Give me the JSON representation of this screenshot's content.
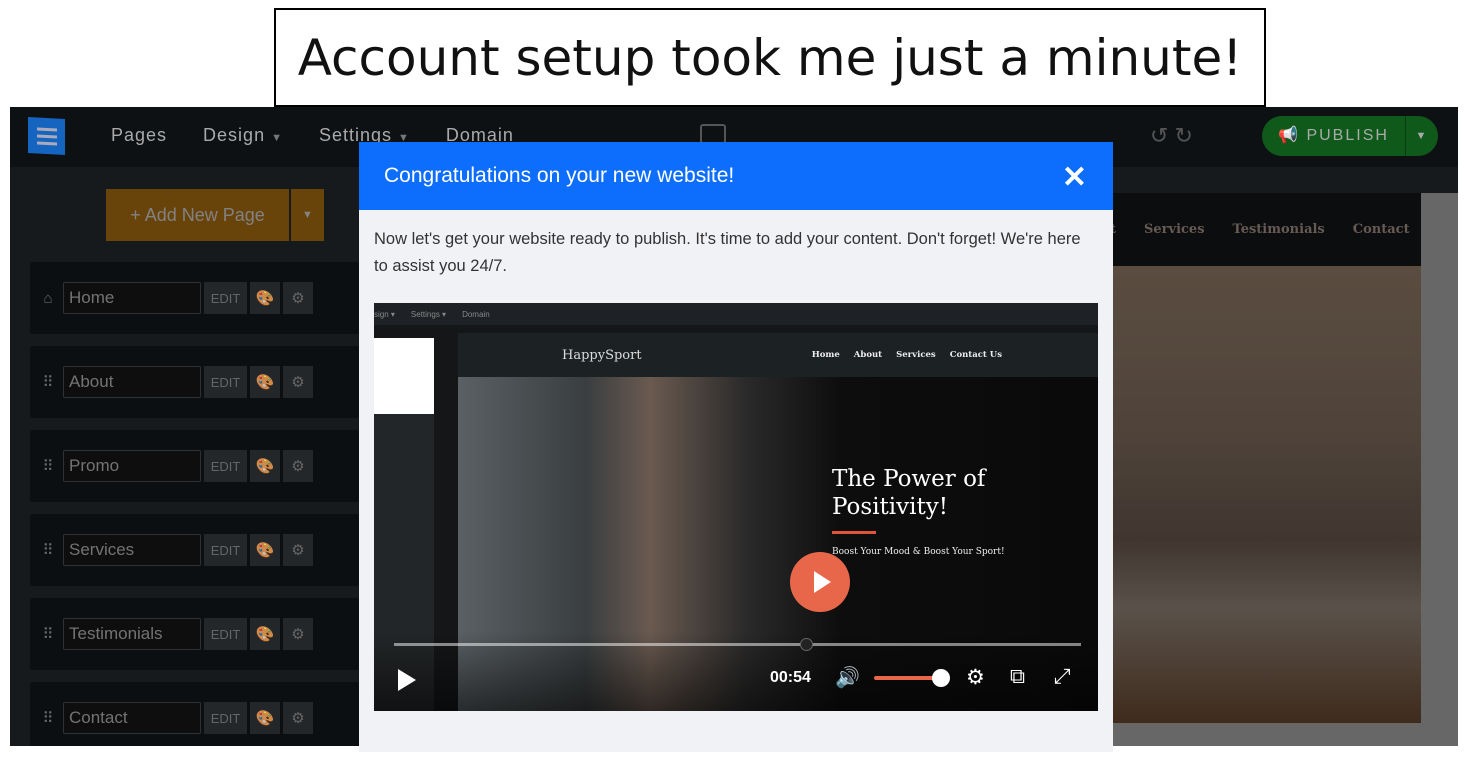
{
  "caption": "Account setup took me just a minute!",
  "topbar": {
    "nav": [
      "Pages",
      "Design",
      "Settings",
      "Domain"
    ],
    "publish_label": "PUBLISH"
  },
  "sidebar": {
    "add_page_label": "+ Add New Page",
    "edit_label": "EDIT",
    "pages": [
      {
        "name": "Home",
        "icon": "home-icon"
      },
      {
        "name": "About",
        "icon": "drag-handle-icon"
      },
      {
        "name": "Promo",
        "icon": "drag-handle-icon"
      },
      {
        "name": "Services",
        "icon": "drag-handle-icon"
      },
      {
        "name": "Testimonials",
        "icon": "drag-handle-icon"
      },
      {
        "name": "Contact",
        "icon": "drag-handle-icon"
      }
    ]
  },
  "preview": {
    "nav": [
      "Services",
      "Testimonials",
      "Contact"
    ],
    "partial_nav": "t"
  },
  "modal": {
    "title": "Congratulations on your new website!",
    "body": "Now let's get your website ready to publish. It's time to add your content. Don't forget! We're here to assist you 24/7.",
    "video": {
      "top_nav": [
        "sign ▾",
        "Settings ▾",
        "Domain"
      ],
      "brand": "HappySport",
      "links": [
        "Home",
        "About",
        "Services",
        "Contact Us"
      ],
      "hero_title": "The Power of Positivity!",
      "hero_sub": "Boost Your Mood & Boost Your Sport!",
      "time": "00:54",
      "progress": 0.6,
      "volume": 0.95
    }
  },
  "colors": {
    "modal_header": "#0d6efd",
    "publish": "#0f5a1a",
    "add_page": "#7c500c",
    "play": "#e8674a"
  }
}
